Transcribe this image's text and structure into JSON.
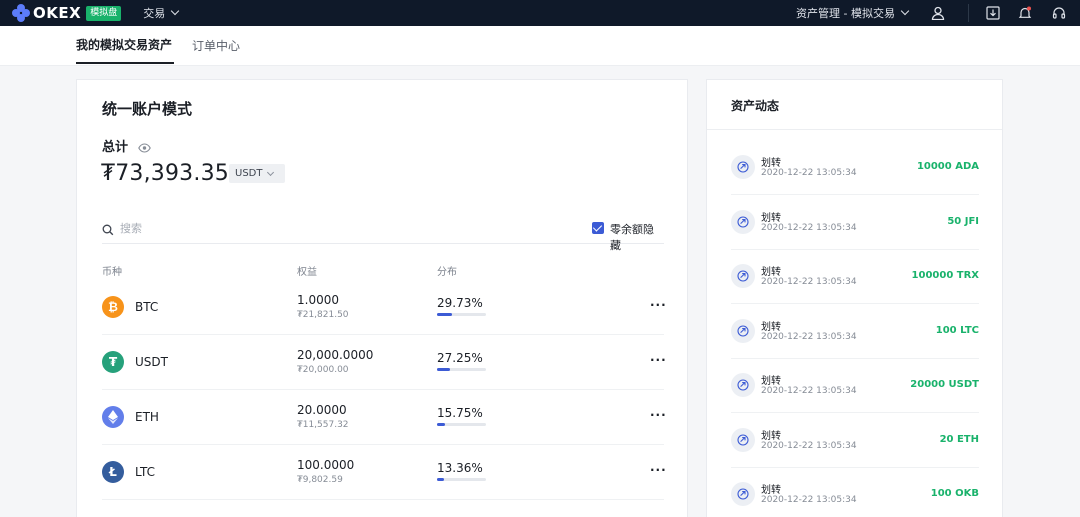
{
  "topbar": {
    "logo_text": "OKEX",
    "demo_badge": "模拟盘",
    "trade_menu": "交易",
    "asset_menu": "资产管理 - 模拟交易",
    "icons": [
      "user-icon",
      "download-icon",
      "bell-icon",
      "headset-icon"
    ]
  },
  "tabs": [
    {
      "label": "我的模拟交易资产",
      "active": true
    },
    {
      "label": "订单中心",
      "active": false
    }
  ],
  "account": {
    "mode_title": "统一账户模式",
    "total_label": "总计",
    "total_value": "₮73,393.35",
    "currency": "USDT"
  },
  "search": {
    "placeholder": "搜索",
    "hide_zero_label": "零余额隐藏",
    "hide_zero_checked": true
  },
  "table": {
    "columns": [
      "币种",
      "权益",
      "分布"
    ],
    "rows": [
      {
        "coin": "BTC",
        "amount": "1.0000",
        "value": "₮21,821.50",
        "pct_label": "29.73%",
        "pct": 29.73,
        "icon": "bitcoin-icon",
        "color": "#f7931a"
      },
      {
        "coin": "USDT",
        "amount": "20,000.0000",
        "value": "₮20,000.00",
        "pct_label": "27.25%",
        "pct": 27.25,
        "icon": "tether-icon",
        "color": "#26a17b"
      },
      {
        "coin": "ETH",
        "amount": "20.0000",
        "value": "₮11,557.32",
        "pct_label": "15.75%",
        "pct": 15.75,
        "icon": "ethereum-icon",
        "color": "#627eea"
      },
      {
        "coin": "LTC",
        "amount": "100.0000",
        "value": "₮9,802.59",
        "pct_label": "13.36%",
        "pct": 13.36,
        "icon": "litecoin-icon",
        "color": "#345d9d"
      }
    ],
    "more_label": "···"
  },
  "activity": {
    "title": "资产动态",
    "items": [
      {
        "type": "划转",
        "time": "2020-12-22 13:05:34",
        "amount": "10000 ADA"
      },
      {
        "type": "划转",
        "time": "2020-12-22 13:05:34",
        "amount": "50 JFI"
      },
      {
        "type": "划转",
        "time": "2020-12-22 13:05:34",
        "amount": "100000 TRX"
      },
      {
        "type": "划转",
        "time": "2020-12-22 13:05:34",
        "amount": "100 LTC"
      },
      {
        "type": "划转",
        "time": "2020-12-22 13:05:34",
        "amount": "20000 USDT"
      },
      {
        "type": "划转",
        "time": "2020-12-22 13:05:34",
        "amount": "20 ETH"
      },
      {
        "type": "划转",
        "time": "2020-12-22 13:05:34",
        "amount": "100 OKB"
      }
    ]
  },
  "colors": {
    "topbar_bg": "#0f1929",
    "accent_blue": "#3c5bd5",
    "positive_green": "#19b26b"
  }
}
